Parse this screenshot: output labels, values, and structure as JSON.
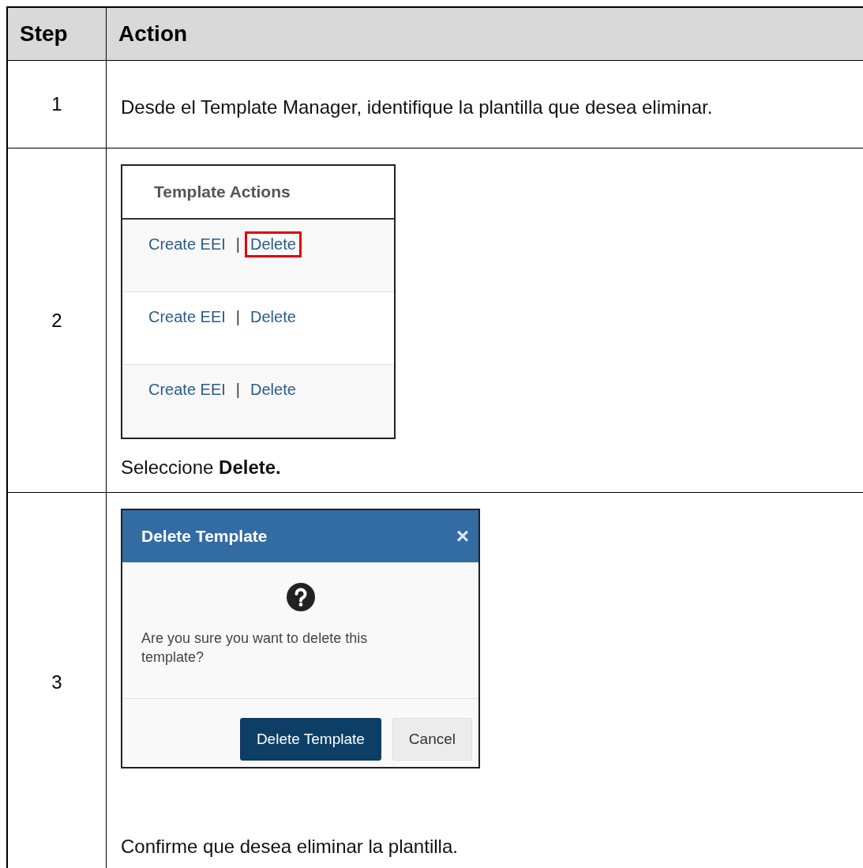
{
  "table": {
    "columns": [
      "Step",
      "Action"
    ],
    "rows": [
      {
        "step": "1",
        "blocks": [
          {
            "kind": "text",
            "text": "Desde el Template Manager, identifique la plantilla que desea eliminar."
          }
        ]
      },
      {
        "step": "2",
        "blocks": [
          {
            "kind": "actions_panel",
            "title": "Template Actions",
            "rows": [
              {
                "create": "Create EEI",
                "separator": "|",
                "delete": "Delete",
                "highlighted": true
              },
              {
                "create": "Create EEI",
                "separator": "|",
                "delete": "Delete",
                "highlighted": false
              },
              {
                "create": "Create EEI",
                "separator": "|",
                "delete": "Delete",
                "highlighted": false
              }
            ]
          },
          {
            "kind": "text",
            "text": "Seleccione **Delete.**"
          }
        ]
      },
      {
        "step": "3",
        "blocks": [
          {
            "kind": "dialog",
            "title": "Delete Template",
            "close": "×",
            "message": "Are you sure you want to delete this template?",
            "buttons": [
              {
                "label": "Delete Template",
                "primary": true
              },
              {
                "label": "Cancel",
                "primary": false
              }
            ]
          },
          {
            "kind": "text",
            "text": "Confirme que desea eliminar la plantilla."
          }
        ]
      }
    ]
  }
}
